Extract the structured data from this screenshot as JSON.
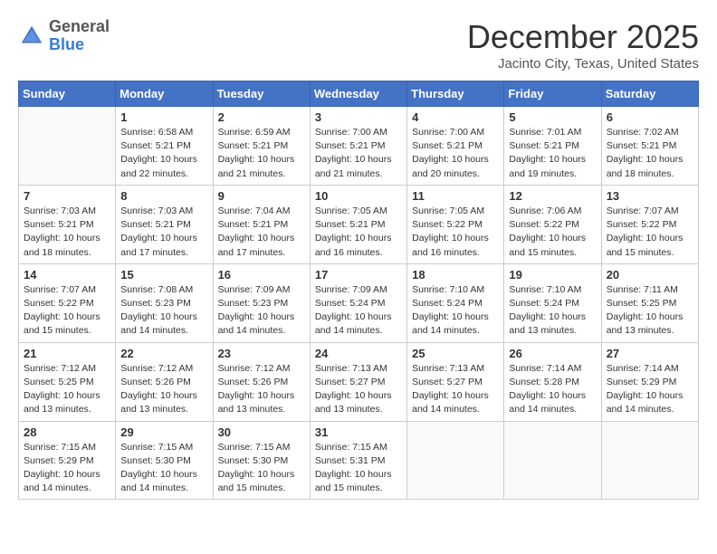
{
  "header": {
    "logo_general": "General",
    "logo_blue": "Blue",
    "month_title": "December 2025",
    "location": "Jacinto City, Texas, United States"
  },
  "calendar": {
    "days_of_week": [
      "Sunday",
      "Monday",
      "Tuesday",
      "Wednesday",
      "Thursday",
      "Friday",
      "Saturday"
    ],
    "weeks": [
      [
        {
          "day": "",
          "info": ""
        },
        {
          "day": "1",
          "info": "Sunrise: 6:58 AM\nSunset: 5:21 PM\nDaylight: 10 hours\nand 22 minutes."
        },
        {
          "day": "2",
          "info": "Sunrise: 6:59 AM\nSunset: 5:21 PM\nDaylight: 10 hours\nand 21 minutes."
        },
        {
          "day": "3",
          "info": "Sunrise: 7:00 AM\nSunset: 5:21 PM\nDaylight: 10 hours\nand 21 minutes."
        },
        {
          "day": "4",
          "info": "Sunrise: 7:00 AM\nSunset: 5:21 PM\nDaylight: 10 hours\nand 20 minutes."
        },
        {
          "day": "5",
          "info": "Sunrise: 7:01 AM\nSunset: 5:21 PM\nDaylight: 10 hours\nand 19 minutes."
        },
        {
          "day": "6",
          "info": "Sunrise: 7:02 AM\nSunset: 5:21 PM\nDaylight: 10 hours\nand 18 minutes."
        }
      ],
      [
        {
          "day": "7",
          "info": "Sunrise: 7:03 AM\nSunset: 5:21 PM\nDaylight: 10 hours\nand 18 minutes."
        },
        {
          "day": "8",
          "info": "Sunrise: 7:03 AM\nSunset: 5:21 PM\nDaylight: 10 hours\nand 17 minutes."
        },
        {
          "day": "9",
          "info": "Sunrise: 7:04 AM\nSunset: 5:21 PM\nDaylight: 10 hours\nand 17 minutes."
        },
        {
          "day": "10",
          "info": "Sunrise: 7:05 AM\nSunset: 5:21 PM\nDaylight: 10 hours\nand 16 minutes."
        },
        {
          "day": "11",
          "info": "Sunrise: 7:05 AM\nSunset: 5:22 PM\nDaylight: 10 hours\nand 16 minutes."
        },
        {
          "day": "12",
          "info": "Sunrise: 7:06 AM\nSunset: 5:22 PM\nDaylight: 10 hours\nand 15 minutes."
        },
        {
          "day": "13",
          "info": "Sunrise: 7:07 AM\nSunset: 5:22 PM\nDaylight: 10 hours\nand 15 minutes."
        }
      ],
      [
        {
          "day": "14",
          "info": "Sunrise: 7:07 AM\nSunset: 5:22 PM\nDaylight: 10 hours\nand 15 minutes."
        },
        {
          "day": "15",
          "info": "Sunrise: 7:08 AM\nSunset: 5:23 PM\nDaylight: 10 hours\nand 14 minutes."
        },
        {
          "day": "16",
          "info": "Sunrise: 7:09 AM\nSunset: 5:23 PM\nDaylight: 10 hours\nand 14 minutes."
        },
        {
          "day": "17",
          "info": "Sunrise: 7:09 AM\nSunset: 5:24 PM\nDaylight: 10 hours\nand 14 minutes."
        },
        {
          "day": "18",
          "info": "Sunrise: 7:10 AM\nSunset: 5:24 PM\nDaylight: 10 hours\nand 14 minutes."
        },
        {
          "day": "19",
          "info": "Sunrise: 7:10 AM\nSunset: 5:24 PM\nDaylight: 10 hours\nand 13 minutes."
        },
        {
          "day": "20",
          "info": "Sunrise: 7:11 AM\nSunset: 5:25 PM\nDaylight: 10 hours\nand 13 minutes."
        }
      ],
      [
        {
          "day": "21",
          "info": "Sunrise: 7:12 AM\nSunset: 5:25 PM\nDaylight: 10 hours\nand 13 minutes."
        },
        {
          "day": "22",
          "info": "Sunrise: 7:12 AM\nSunset: 5:26 PM\nDaylight: 10 hours\nand 13 minutes."
        },
        {
          "day": "23",
          "info": "Sunrise: 7:12 AM\nSunset: 5:26 PM\nDaylight: 10 hours\nand 13 minutes."
        },
        {
          "day": "24",
          "info": "Sunrise: 7:13 AM\nSunset: 5:27 PM\nDaylight: 10 hours\nand 13 minutes."
        },
        {
          "day": "25",
          "info": "Sunrise: 7:13 AM\nSunset: 5:27 PM\nDaylight: 10 hours\nand 14 minutes."
        },
        {
          "day": "26",
          "info": "Sunrise: 7:14 AM\nSunset: 5:28 PM\nDaylight: 10 hours\nand 14 minutes."
        },
        {
          "day": "27",
          "info": "Sunrise: 7:14 AM\nSunset: 5:29 PM\nDaylight: 10 hours\nand 14 minutes."
        }
      ],
      [
        {
          "day": "28",
          "info": "Sunrise: 7:15 AM\nSunset: 5:29 PM\nDaylight: 10 hours\nand 14 minutes."
        },
        {
          "day": "29",
          "info": "Sunrise: 7:15 AM\nSunset: 5:30 PM\nDaylight: 10 hours\nand 14 minutes."
        },
        {
          "day": "30",
          "info": "Sunrise: 7:15 AM\nSunset: 5:30 PM\nDaylight: 10 hours\nand 15 minutes."
        },
        {
          "day": "31",
          "info": "Sunrise: 7:15 AM\nSunset: 5:31 PM\nDaylight: 10 hours\nand 15 minutes."
        },
        {
          "day": "",
          "info": ""
        },
        {
          "day": "",
          "info": ""
        },
        {
          "day": "",
          "info": ""
        }
      ]
    ]
  }
}
